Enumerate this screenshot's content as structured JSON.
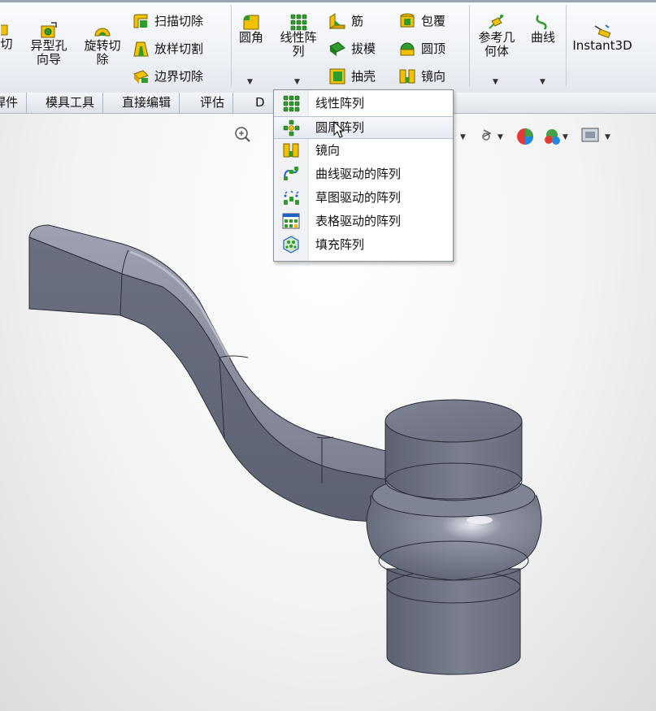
{
  "ribbon": {
    "cut_partial": "切",
    "hole_wizard": "异型孔\n向导",
    "revolved_cut": "旋转切\n除",
    "swept_cut": "扫描切除",
    "lofted_cut": "放样切割",
    "boundary_cut": "边界切除",
    "fillet": "圆角",
    "linear_pattern": "线性阵\n列",
    "rib": "筋",
    "draft": "拔模",
    "shell": "抽壳",
    "wrap": "包覆",
    "dome": "圆顶",
    "mirror": "镜向",
    "reference_geometry": "参考几\n何体",
    "curves": "曲线",
    "instant3d": "Instant3D"
  },
  "tabs": [
    "焊件",
    "模具工具",
    "直接编辑",
    "评估",
    "D"
  ],
  "flyout": {
    "items": [
      {
        "label": "线性阵列",
        "icon": "linear-pattern-icon"
      },
      {
        "label": "圆周阵列",
        "icon": "circular-pattern-icon",
        "highlighted": true
      },
      {
        "label": "镜向",
        "icon": "mirror-icon"
      },
      {
        "label": "曲线驱动的阵列",
        "icon": "curve-driven-pattern-icon"
      },
      {
        "label": "草图驱动的阵列",
        "icon": "sketch-driven-pattern-icon"
      },
      {
        "label": "表格驱动的阵列",
        "icon": "table-driven-pattern-icon"
      },
      {
        "label": "填充阵列",
        "icon": "fill-pattern-icon"
      }
    ]
  },
  "colors": {
    "part_body": "#6f7484",
    "part_highlight": "#a9adbb",
    "icon_green": "#2f9b2a",
    "icon_yellow": "#f2c200",
    "ribbon_bg": "#eef1f6"
  }
}
